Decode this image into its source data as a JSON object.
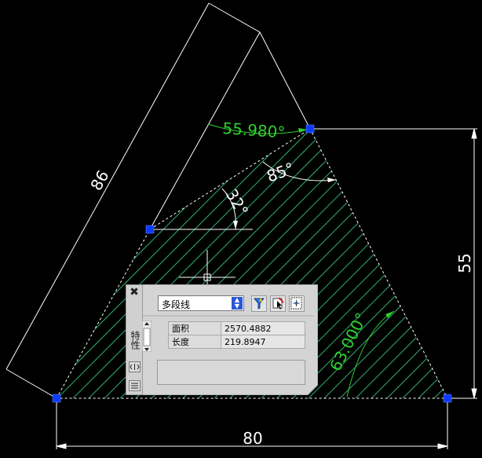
{
  "drawing": {
    "dimensions": {
      "top_width": "80",
      "right_height": "55",
      "slanted_length": "86"
    },
    "angles": {
      "top_vertex": "55.980°",
      "inner_top": "85°",
      "inner_left": "32°",
      "bottom_right": "63.000°"
    },
    "colors": {
      "background": "#000000",
      "geometry": "#ffffff",
      "hatch": "#2fae6b",
      "angle_dims": "#2fd12f",
      "grips": "#0a3cff"
    }
  },
  "properties_palette": {
    "title": "特性",
    "close_icon": "close-icon",
    "object_type": "多段线",
    "tools": [
      "quick-select-icon",
      "select-objects-icon",
      "pickadd-toggle-icon"
    ],
    "properties": [
      {
        "label": "面积",
        "value": "2570.4882"
      },
      {
        "label": "长度",
        "value": "219.8947"
      }
    ],
    "colors": {
      "panel": "#d4d4d4",
      "dropdown_button": "#2a57d6"
    }
  }
}
